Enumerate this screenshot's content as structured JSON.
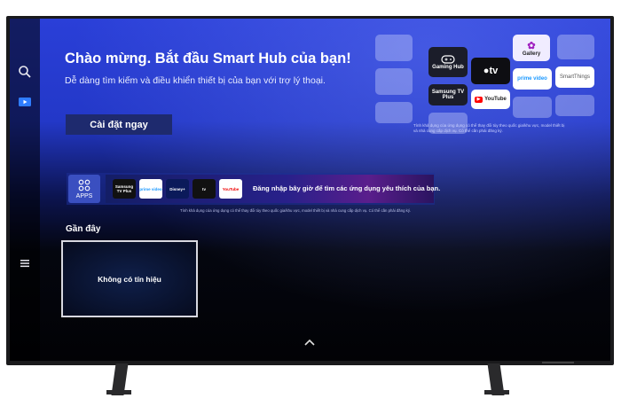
{
  "hero": {
    "title": "Chào mừng. Bắt đầu Smart Hub của bạn!",
    "subtitle": "Dễ dàng tìm kiếm và điều khiển thiết bị của bạn với trợ lý thoại.",
    "setup_button": "Cài đặt ngay",
    "disclaimer": "Tính khả dụng của ứng dụng có thể thay đổi tùy theo quốc gia/khu vực, model thiết bị và nhà cung cấp dịch vụ. Có thể cần phải đăng ký."
  },
  "hero_tiles": {
    "gaming_hub": "Gaming Hub",
    "gallery": "Gallery",
    "apple_tv": "tv",
    "samsung_tv_plus": "Samsung TV Plus",
    "prime_video": "prime video",
    "smartthings": "SmartThings",
    "youtube": "YouTube"
  },
  "apps_row": {
    "apps_label": "APPS",
    "mini_apps": [
      "Samsung TV Plus",
      "prime video",
      "Disney+",
      "tv",
      "YouTube"
    ],
    "promo_text": "Đăng nhập bây giờ để tìm các ứng dụng yêu thích của bạn.",
    "disclaimer": "Tính khả dụng của ứng dụng có thể thay đổi tùy theo quốc gia/khu vực, model thiết bị và nhà cung cấp dịch vụ. Có thể cần phải đăng ký."
  },
  "recent": {
    "label": "Gần đây",
    "card_text": "Không có tín hiệu"
  },
  "sidebar": {
    "icons": [
      "search-icon",
      "source-icon",
      "menu-icon"
    ]
  },
  "colors": {
    "accent": "#2338c8",
    "button_bg": "#1e2a6e",
    "selected_source": "#2f7dff"
  }
}
